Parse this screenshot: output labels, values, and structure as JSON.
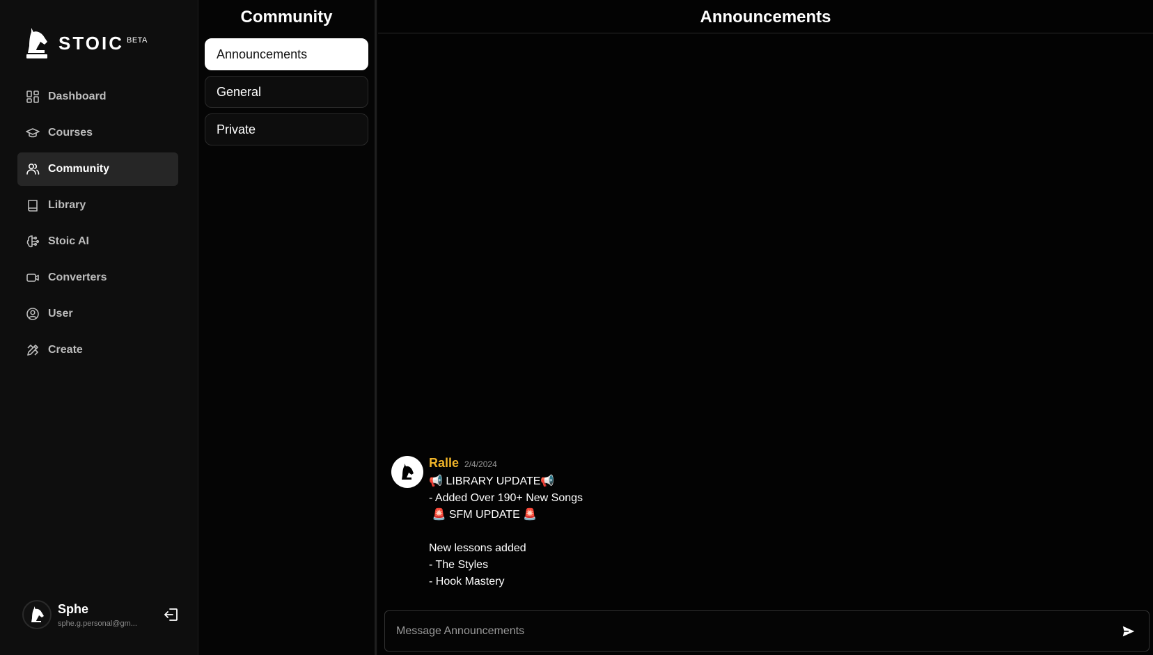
{
  "brand": {
    "name": "STOIC",
    "badge": "BETA"
  },
  "sidebar": {
    "items": [
      {
        "label": "Dashboard",
        "icon": "dashboard-icon"
      },
      {
        "label": "Courses",
        "icon": "graduation-cap-icon"
      },
      {
        "label": "Community",
        "icon": "users-icon",
        "active": true
      },
      {
        "label": "Library",
        "icon": "book-icon"
      },
      {
        "label": "Stoic AI",
        "icon": "brain-circuit-icon"
      },
      {
        "label": "Converters",
        "icon": "video-icon"
      },
      {
        "label": "User",
        "icon": "user-circle-icon"
      },
      {
        "label": "Create",
        "icon": "pencil-ruler-icon"
      }
    ]
  },
  "user": {
    "name": "Sphe",
    "email": "sphe.g.personal@gm..."
  },
  "channels": {
    "title": "Community",
    "items": [
      {
        "label": "Announcements",
        "active": true
      },
      {
        "label": "General"
      },
      {
        "label": "Private"
      }
    ]
  },
  "main": {
    "title": "Announcements",
    "messages": [
      {
        "author": "Ralle",
        "date": "2/4/2024",
        "lines": [
          "📢 LIBRARY UPDATE📢",
          "- Added Over 190+ New Songs",
          " 🚨 SFM UPDATE 🚨",
          "",
          "New lessons added",
          "- The Styles",
          "- Hook Mastery"
        ]
      }
    ],
    "composer_placeholder": "Message Announcements"
  },
  "colors": {
    "accent_author": "#f0b429",
    "background": "#050505",
    "sidebar": "#0e0e0e"
  }
}
